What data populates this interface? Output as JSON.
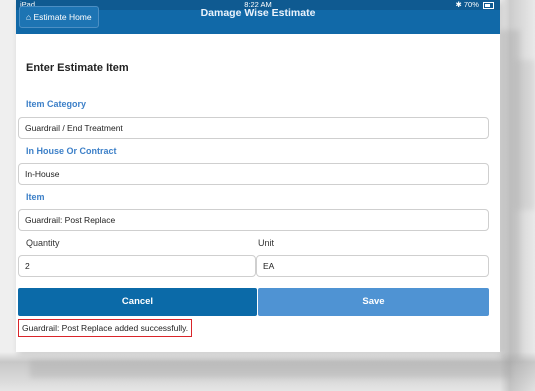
{
  "statusbar": {
    "device": "iPad",
    "time": "8:22 AM",
    "battery": "70%"
  },
  "navbar": {
    "home_label": "Estimate Home",
    "title": "Damage Wise Estimate"
  },
  "form": {
    "heading": "Enter Estimate Item",
    "item_category": {
      "label": "Item Category",
      "value": "Guardrail / End Treatment"
    },
    "in_house_or_contract": {
      "label": "In House Or Contract",
      "value": "In-House"
    },
    "item": {
      "label": "Item",
      "value": "Guardrail: Post Replace"
    },
    "quantity": {
      "label": "Quantity",
      "value": "2"
    },
    "unit": {
      "label": "Unit",
      "value": "EA"
    },
    "cancel_label": "Cancel",
    "save_label": "Save",
    "success_message": "Guardrail: Post Replace added successfully."
  },
  "colors": {
    "primary": "#1169a8",
    "save": "#4f93d3",
    "label": "#3d80c8",
    "error_border": "#d9252a"
  }
}
